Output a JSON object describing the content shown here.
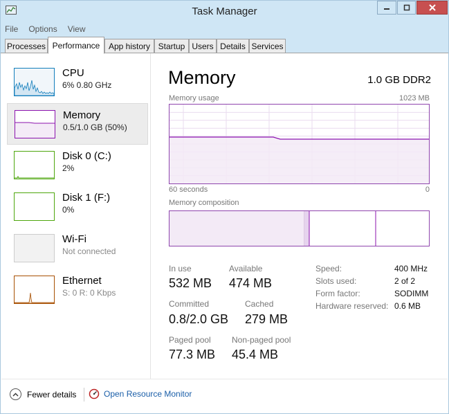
{
  "window": {
    "title": "Task Manager"
  },
  "menu": [
    "File",
    "Options",
    "View"
  ],
  "tabs": [
    "Processes",
    "Performance",
    "App history",
    "Startup",
    "Users",
    "Details",
    "Services"
  ],
  "active_tab": "Performance",
  "sidebar": {
    "items": [
      {
        "name": "CPU",
        "detail": "6% 0.80 GHz",
        "color": "#117dbb"
      },
      {
        "name": "Memory",
        "detail": "0.5/1.0 GB (50%)",
        "color": "#8b12ae"
      },
      {
        "name": "Disk 0 (C:)",
        "detail": "2%",
        "color": "#4da60c"
      },
      {
        "name": "Disk 1 (F:)",
        "detail": "0%",
        "color": "#4da60c"
      },
      {
        "name": "Wi-Fi",
        "detail": "Not connected",
        "color": "#bbbbbb"
      },
      {
        "name": "Ethernet",
        "detail": "S: 0 R: 0 Kbps",
        "color": "#a74f01"
      }
    ]
  },
  "memory": {
    "heading": "Memory",
    "spec": "1.0 GB DDR2",
    "usage_label": "Memory usage",
    "usage_max": "1023 MB",
    "time_left": "60 seconds",
    "time_right": "0",
    "composition_label": "Memory composition",
    "composition": {
      "in_use_fraction": 0.52,
      "modified_fraction": 0.02,
      "standby_fraction": 0.26,
      "free_fraction": 0.2
    },
    "stats": {
      "in_use_label": "In use",
      "in_use": "532 MB",
      "available_label": "Available",
      "available": "474 MB",
      "committed_label": "Committed",
      "committed": "0.8/2.0 GB",
      "cached_label": "Cached",
      "cached": "279 MB",
      "paged_label": "Paged pool",
      "paged": "77.3 MB",
      "nonpaged_label": "Non-paged pool",
      "nonpaged": "45.4 MB"
    },
    "props": {
      "speed_label": "Speed:",
      "speed": "400 MHz",
      "slots_label": "Slots used:",
      "slots": "2 of 2",
      "form_label": "Form factor:",
      "form": "SODIMM",
      "reserved_label": "Hardware reserved:",
      "reserved": "0.6 MB"
    }
  },
  "footer": {
    "fewer_details": "Fewer details",
    "resource_monitor": "Open Resource Monitor"
  }
}
